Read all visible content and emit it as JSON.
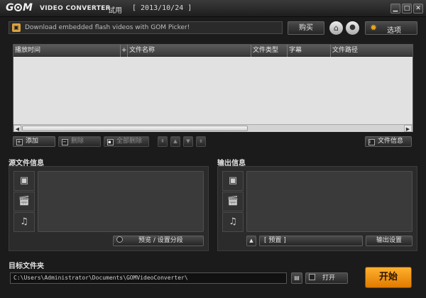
{
  "titlebar": {
    "subtitle": "VIDEO CONVERTER",
    "trial": "试用",
    "date": "[ 2013/10/24 ]"
  },
  "banner": {
    "text": "Download embedded flash videos with GOM Picker!"
  },
  "toolbar_top": {
    "buy_label": "购买",
    "options_label": "选项"
  },
  "file_table": {
    "columns": [
      "播放时间",
      "文件名称",
      "文件类型",
      "字幕",
      "文件路径"
    ]
  },
  "list_buttons": {
    "add_label": "添加",
    "remove_label": "删除",
    "remove_all_label": "全部删除",
    "file_info_label": "文件信息"
  },
  "source_panel": {
    "title": "源文件信息",
    "settings_label": "预览 / 设置分段"
  },
  "output_panel": {
    "title": "输出信息",
    "preset_label": "[ 预置 ]",
    "output_settings_label": "输出设置"
  },
  "destination": {
    "title": "目标文件夹",
    "path": "C:\\Users\\Administrator\\Documents\\GOMVideoConverter\\",
    "open_label": "打开"
  },
  "start_label": "开始"
}
